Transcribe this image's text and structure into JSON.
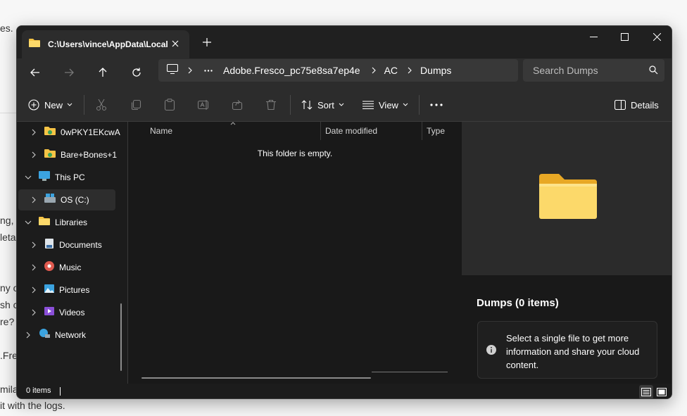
{
  "background": {
    "lines": [
      "es.",
      "ng,",
      "leta",
      "ny o",
      "sh c",
      "re?",
      ".Fre",
      "mila"
    ],
    "bottom_line": " it with the logs."
  },
  "window": {
    "tab_title": "C:\\Users\\vince\\AppData\\Local",
    "controls": {
      "minimize": "minimize",
      "maximize": "maximize",
      "close": "close"
    }
  },
  "address": {
    "crumbs": [
      "Adobe.Fresco_pc75e8sa7ep4e",
      "AC",
      "Dumps"
    ],
    "search_placeholder": "Search Dumps"
  },
  "toolbar": {
    "new_label": "New",
    "sort_label": "Sort",
    "view_label": "View",
    "details_label": "Details"
  },
  "sidebar": {
    "items": [
      {
        "label": "0wPKY1EKcwA"
      },
      {
        "label": "Bare+Bones+1"
      },
      {
        "label": "This PC"
      },
      {
        "label": "OS (C:)"
      },
      {
        "label": "Libraries"
      },
      {
        "label": "Documents"
      },
      {
        "label": "Music"
      },
      {
        "label": "Pictures"
      },
      {
        "label": "Videos"
      },
      {
        "label": "Network"
      }
    ]
  },
  "content": {
    "columns": [
      "Name",
      "Date modified",
      "Type"
    ],
    "empty_message": "This folder is empty."
  },
  "details": {
    "title": "Dumps (0 items)",
    "info": "Select a single file to get more information and share your cloud content."
  },
  "status": {
    "items": "0 items"
  },
  "colors": {
    "window_bg": "#191919",
    "chrome_bg": "#2c2c2c",
    "folder_yellow": "#f6c445"
  }
}
